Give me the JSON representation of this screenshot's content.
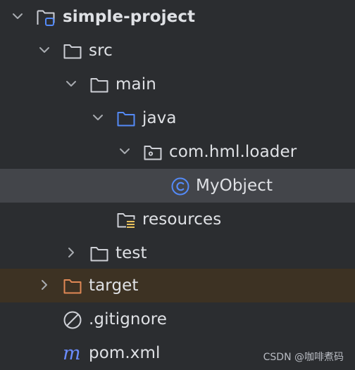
{
  "tree": {
    "rows": [
      {
        "label": "simple-project",
        "icon": "module-folder-icon",
        "expanded": true,
        "bold": true
      },
      {
        "label": "src",
        "icon": "folder-icon",
        "expanded": true
      },
      {
        "label": "main",
        "icon": "folder-icon",
        "expanded": true
      },
      {
        "label": "java",
        "icon": "source-root-folder-icon",
        "expanded": true
      },
      {
        "label": "com.hml.loader",
        "icon": "package-icon",
        "expanded": true
      },
      {
        "label": "MyObject",
        "icon": "java-class-icon",
        "selected": true
      },
      {
        "label": "resources",
        "icon": "resources-folder-icon"
      },
      {
        "label": "test",
        "icon": "folder-icon",
        "expanded": false
      },
      {
        "label": "target",
        "icon": "excluded-folder-icon",
        "expanded": false
      },
      {
        "label": ".gitignore",
        "icon": "ignored-file-icon"
      },
      {
        "label": "pom.xml",
        "icon": "maven-icon"
      }
    ]
  },
  "colors": {
    "background": "#2b2d30",
    "selected_row": "#43454a",
    "excluded_row": "#3d3223",
    "source_folder": "#548af7",
    "excluded_folder": "#e08855",
    "maven": "#6b8cff"
  },
  "watermark": {
    "text": "CSDN @咖啡煮码"
  }
}
